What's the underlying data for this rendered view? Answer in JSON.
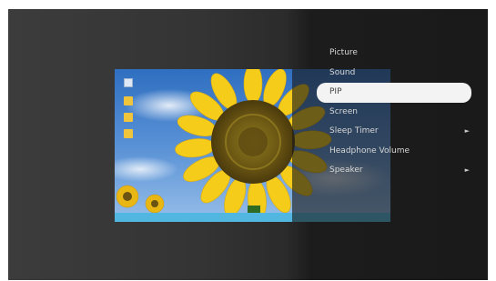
{
  "menu": {
    "items": [
      {
        "label": "Picture",
        "arrow": ""
      },
      {
        "label": "Sound",
        "arrow": ""
      },
      {
        "label": "PIP",
        "arrow": ""
      },
      {
        "label": "Screen",
        "arrow": ""
      },
      {
        "label": "Sleep Timer",
        "arrow": "►"
      },
      {
        "label": "Headphone Volume",
        "arrow": ""
      },
      {
        "label": "Speaker",
        "arrow": "►"
      }
    ],
    "selected_index": 2
  },
  "colors": {
    "taskbar": "#52b7e0",
    "sky": "#4f8bd2",
    "petals": "#f6cf1e",
    "selected_highlight": "#f3f3f3"
  },
  "icons": [
    "document-icon",
    "folder-icon",
    "folder-icon",
    "folder-icon"
  ]
}
